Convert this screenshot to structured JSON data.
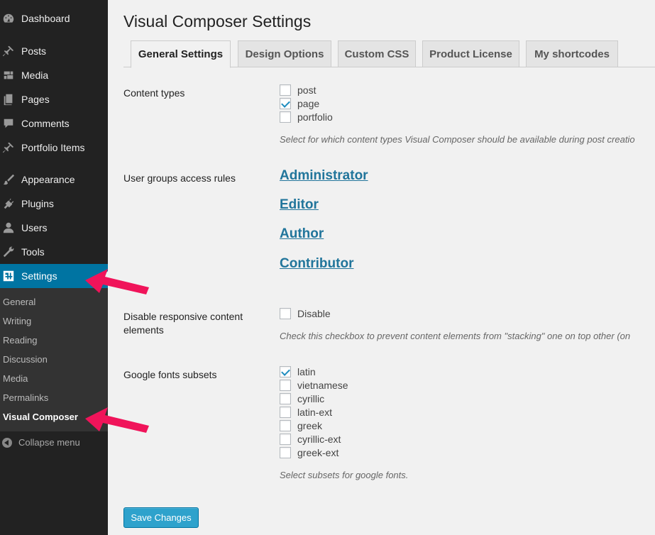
{
  "sidebar": {
    "items": [
      {
        "label": "Dashboard",
        "icon": "dashboard-icon"
      },
      {
        "label": "Posts",
        "icon": "pin-icon"
      },
      {
        "label": "Media",
        "icon": "media-icon"
      },
      {
        "label": "Pages",
        "icon": "pages-icon"
      },
      {
        "label": "Comments",
        "icon": "comment-icon"
      },
      {
        "label": "Portfolio Items",
        "icon": "pin-icon"
      },
      {
        "label": "Appearance",
        "icon": "brush-icon"
      },
      {
        "label": "Plugins",
        "icon": "plug-icon"
      },
      {
        "label": "Users",
        "icon": "user-icon"
      },
      {
        "label": "Tools",
        "icon": "wrench-icon"
      },
      {
        "label": "Settings",
        "icon": "settings-icon"
      }
    ],
    "submenu": [
      "General",
      "Writing",
      "Reading",
      "Discussion",
      "Media",
      "Permalinks",
      "Visual Composer"
    ],
    "collapse_label": "Collapse menu"
  },
  "page": {
    "title": "Visual Composer Settings",
    "tabs": [
      "General Settings",
      "Design Options",
      "Custom CSS",
      "Product License",
      "My shortcodes"
    ]
  },
  "content_types": {
    "label": "Content types",
    "options": [
      {
        "label": "post",
        "checked": false
      },
      {
        "label": "page",
        "checked": true
      },
      {
        "label": "portfolio",
        "checked": false
      }
    ],
    "description": "Select for which content types Visual Composer should be available during post creatio"
  },
  "user_groups": {
    "label": "User groups access rules",
    "roles": [
      "Administrator",
      "Editor",
      "Author",
      "Contributor"
    ]
  },
  "responsive": {
    "label": "Disable responsive content elements",
    "option": {
      "label": "Disable",
      "checked": false
    },
    "description": "Check this checkbox to prevent content elements from \"stacking\" one on top other (on"
  },
  "google_fonts": {
    "label": "Google fonts subsets",
    "options": [
      {
        "label": "latin",
        "checked": true
      },
      {
        "label": "vietnamese",
        "checked": false
      },
      {
        "label": "cyrillic",
        "checked": false
      },
      {
        "label": "latin-ext",
        "checked": false
      },
      {
        "label": "greek",
        "checked": false
      },
      {
        "label": "cyrillic-ext",
        "checked": false
      },
      {
        "label": "greek-ext",
        "checked": false
      }
    ],
    "description": "Select subsets for google fonts."
  },
  "save_label": "Save Changes",
  "colors": {
    "sidebar_bg": "#222222",
    "active_bg": "#0074a2",
    "link": "#21759b",
    "arrow": "#f0145a",
    "button": "#2ea2cc"
  }
}
